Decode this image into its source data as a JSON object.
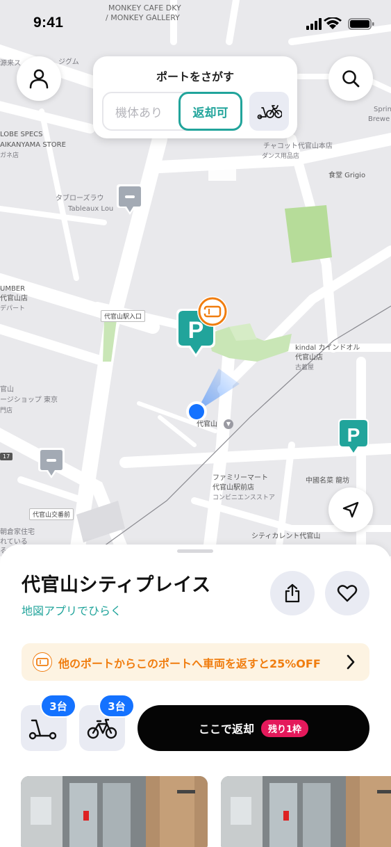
{
  "status_bar": {
    "time": "9:41"
  },
  "map": {
    "labels": {
      "monkey_cafe": "MONKEY CAFE DKY",
      "monkey_gallery": "/ MONKEY GALLERY",
      "jigumu": "ジグム",
      "genteki": "源来ス",
      "globe_specs": "LOBE SPECS",
      "daikanyama_store": "AIKANYAMA STORE",
      "gane": "ガネ店",
      "tablowes_jp": "タブローズラウ",
      "tableaux": "Tableaux Lou",
      "chacott": "チャコット代官山本店",
      "dance_goods": "ダンス用品店",
      "grigio": "食堂 Grigio",
      "spring": "Sprin",
      "brewer": "Brewe",
      "umber": "UMBER",
      "daikanyama_ten": "代官山店",
      "depart": "デパート",
      "station_exit": "代官山駅入口",
      "kindal": "kindal カインドオル",
      "kindal_daikanyama": "代官山店",
      "kindal_used": "古着屋",
      "daikanyama_left": "官山",
      "shop_tokyo": "ージショップ 東京",
      "kanbai": "門店",
      "daikanyama_station": "代官山",
      "familymart": "ファミリーマート",
      "familymart_branch": "代官山駅前店",
      "convenience": "コンビニエンスストア",
      "chinese": "中國名菜 龍坊",
      "koban": "代官山交番前",
      "asakura": "朝倉家住宅",
      "hiraku": "れている",
      "shiki": "る",
      "city_current": "シティカレント代官山",
      "route_17": "17"
    }
  },
  "port_search": {
    "title": "ポートをさがす",
    "filter_available": "機体あり",
    "filter_returnable": "返却可",
    "bike_toggle_icon": "scooter-bike-icon"
  },
  "sheet": {
    "title": "代官山シティプレイス",
    "open_map_link": "地図アプリでひらく",
    "promo_text": "他のポートからこのポートへ車両を返すと25%OFF",
    "vehicles": [
      {
        "type": "kickboard",
        "count": "3台"
      },
      {
        "type": "bicycle",
        "count": "3台"
      }
    ],
    "return_label": "ここで返却",
    "slots_badge": "残り1枠"
  },
  "colors": {
    "teal": "#21a49b",
    "orange": "#f07d0f",
    "blue": "#1472ff",
    "pink": "#e4195b",
    "map_bg": "#e9e9ec"
  }
}
